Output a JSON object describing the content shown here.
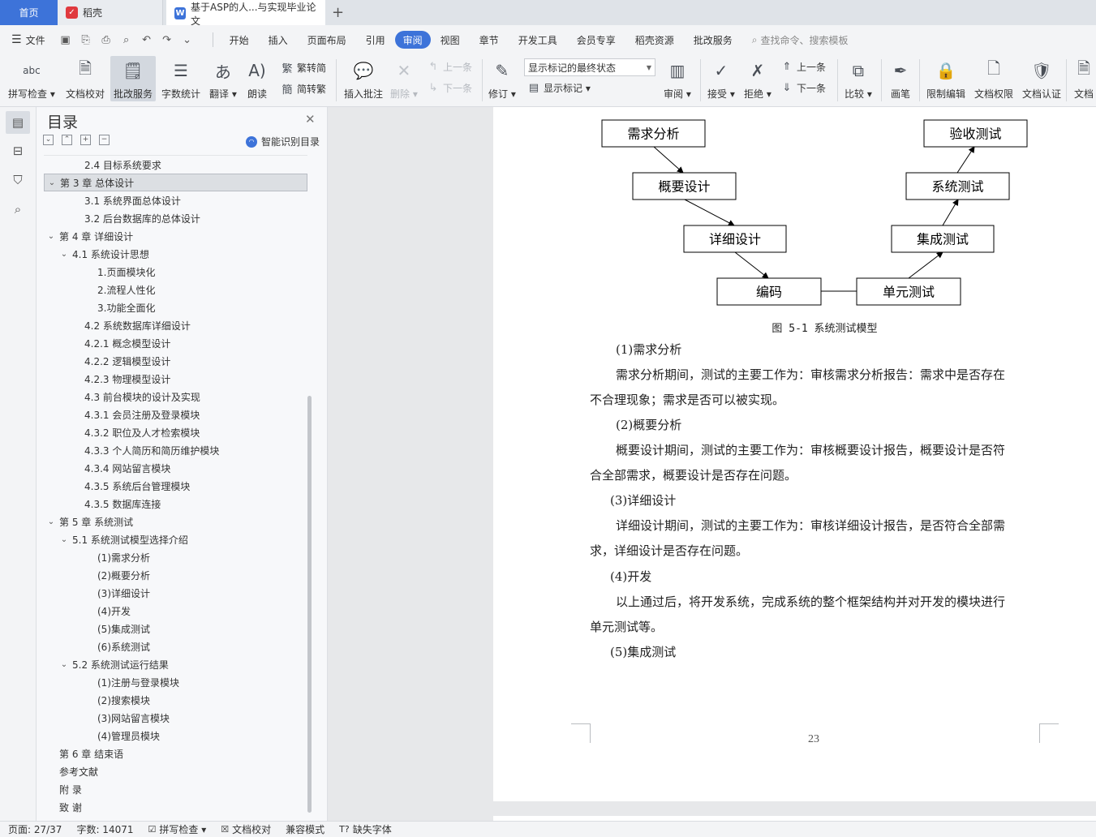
{
  "tabs": {
    "home": "首页",
    "daoke": "稻壳",
    "doc": "基于ASP的人...与实现毕业论文",
    "plus": "+"
  },
  "menu": {
    "file": "文件",
    "items": [
      "开始",
      "插入",
      "页面布局",
      "引用",
      "审阅",
      "视图",
      "章节",
      "开发工具",
      "会员专享",
      "稻壳资源",
      "批改服务"
    ],
    "active": "审阅",
    "search_placeholder": "查找命令、搜索模板"
  },
  "ribbon": {
    "spell": "拼写检查",
    "doccheck": "文档校对",
    "revise_service": "批改服务",
    "wordcount": "字数统计",
    "translate": "翻译",
    "read": "朗读",
    "trad_simp": "繁转简",
    "simp_trad": "简转繁",
    "insert_comment": "插入批注",
    "delete": "删除",
    "prev": "上一条",
    "next": "下一条",
    "track": "修订",
    "markup_state": "显示标记的最终状态",
    "show_markup": "显示标记",
    "review": "审阅",
    "accept": "接受",
    "reject": "拒绝",
    "prev2": "上一条",
    "next2": "下一条",
    "compare": "比较",
    "pen": "画笔",
    "restrict": "限制编辑",
    "doc_perm": "文档权限",
    "doc_cert": "文档认证",
    "doc_more": "文档"
  },
  "nav": {
    "title": "目录",
    "ai_label": "智能识别目录",
    "items": [
      {
        "text": "2.4 目标系统要求",
        "level": 2,
        "toggle": ""
      },
      {
        "text": "第 3 章  总体设计",
        "level": 0,
        "toggle": "v",
        "selected": true
      },
      {
        "text": "3.1 系统界面总体设计",
        "level": 2,
        "toggle": ""
      },
      {
        "text": "3.2  后台数据库的总体设计",
        "level": 2,
        "toggle": ""
      },
      {
        "text": "第 4 章  详细设计",
        "level": 0,
        "toggle": "v"
      },
      {
        "text": "4.1 系统设计思想",
        "level": 1,
        "toggle": "v"
      },
      {
        "text": "1.页面模块化",
        "level": 3,
        "toggle": ""
      },
      {
        "text": "2.流程人性化",
        "level": 3,
        "toggle": ""
      },
      {
        "text": "3.功能全面化",
        "level": 3,
        "toggle": ""
      },
      {
        "text": "4.2 系统数据库详细设计",
        "level": 2,
        "toggle": ""
      },
      {
        "text": "4.2.1 概念模型设计",
        "level": 2,
        "toggle": ""
      },
      {
        "text": "4.2.2 逻辑模型设计",
        "level": 2,
        "toggle": ""
      },
      {
        "text": "4.2.3 物理模型设计",
        "level": 2,
        "toggle": ""
      },
      {
        "text": "4.3 前台模块的设计及实现",
        "level": 2,
        "toggle": ""
      },
      {
        "text": "4.3.1 会员注册及登录模块",
        "level": 2,
        "toggle": ""
      },
      {
        "text": "4.3.2 职位及人才检索模块",
        "level": 2,
        "toggle": ""
      },
      {
        "text": "4.3.3 个人简历和简历维护模块",
        "level": 2,
        "toggle": ""
      },
      {
        "text": "4.3.4 网站留言模块",
        "level": 2,
        "toggle": ""
      },
      {
        "text": "4.3.5 系统后台管理模块",
        "level": 2,
        "toggle": ""
      },
      {
        "text": "4.3.5 数据库连接",
        "level": 2,
        "toggle": ""
      },
      {
        "text": "第 5 章  系统测试",
        "level": 0,
        "toggle": "v"
      },
      {
        "text": "5.1 系统测试模型选择介绍",
        "level": 1,
        "toggle": "v"
      },
      {
        "text": "(1)需求分析",
        "level": 3,
        "toggle": ""
      },
      {
        "text": "(2)概要分析",
        "level": 3,
        "toggle": ""
      },
      {
        "text": "(3)详细设计",
        "level": 3,
        "toggle": ""
      },
      {
        "text": "(4)开发",
        "level": 3,
        "toggle": ""
      },
      {
        "text": "(5)集成测试",
        "level": 3,
        "toggle": ""
      },
      {
        "text": "(6)系统测试",
        "level": 3,
        "toggle": ""
      },
      {
        "text": "5.2 系统测试运行结果",
        "level": 1,
        "toggle": "v"
      },
      {
        "text": "(1)注册与登录模块",
        "level": 3,
        "toggle": ""
      },
      {
        "text": "(2)搜索模块",
        "level": 3,
        "toggle": ""
      },
      {
        "text": "(3)网站留言模块",
        "level": 3,
        "toggle": ""
      },
      {
        "text": "(4)管理员模块",
        "level": 3,
        "toggle": ""
      },
      {
        "text": "第 6 章 结束语",
        "level": 0,
        "toggle": ""
      },
      {
        "text": "参考文献",
        "level": 0,
        "toggle": ""
      },
      {
        "text": "附  录",
        "level": 0,
        "toggle": ""
      },
      {
        "text": "致  谢",
        "level": 0,
        "toggle": ""
      }
    ]
  },
  "diagram": {
    "nodes": [
      "需求分析",
      "概要设计",
      "详细设计",
      "编码",
      "单元测试",
      "集成测试",
      "系统测试",
      "验收测试"
    ],
    "caption": "图 5-1 系统测试模型"
  },
  "doc": {
    "paragraphs": [
      "(1)需求分析",
      "需求分析期间，测试的主要工作为：审核需求分析报告：需求中是否存在",
      "不合理现象；需求是否可以被实现。",
      "(2)概要分析",
      "概要设计期间，测试的主要工作为：审核概要设计报告，概要设计是否符",
      "合全部需求，概要设计是否存在问题。",
      "(3)详细设计",
      "详细设计期间，测试的主要工作为：审核详细设计报告，是否符合全部需",
      "求，详细设计是否存在问题。",
      "(4)开发",
      "以上通过后，将开发系统，完成系统的整个框架结构并对开发的模块进行",
      "单元测试等。",
      "(5)集成测试"
    ],
    "page_number": "23"
  },
  "status": {
    "page": "页面: 27/37",
    "words": "字数: 14071",
    "spell": "拼写检查",
    "doccheck": "文档校对",
    "compat": "兼容模式",
    "missing_font": "缺失字体"
  },
  "colors": {
    "accent": "#3d73d9",
    "daoke": "#e0393e"
  }
}
